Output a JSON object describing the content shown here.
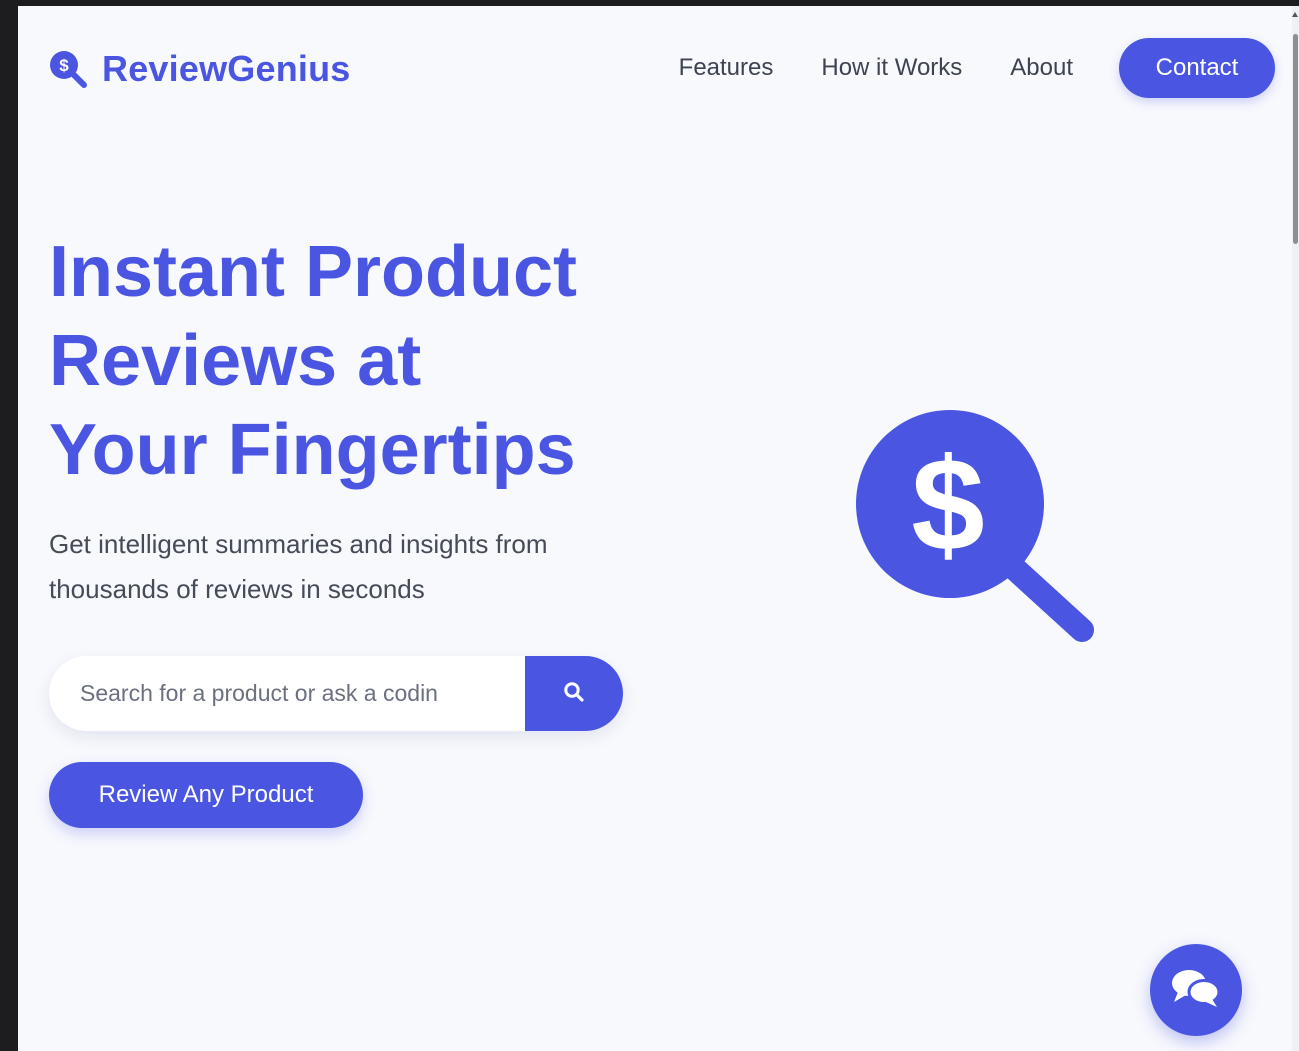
{
  "brand": {
    "name": "ReviewGenius",
    "accent_color": "#4a56e2",
    "logo_icon": "dollar-magnifier-icon"
  },
  "nav": {
    "links": [
      "Features",
      "How it Works",
      "About"
    ],
    "contact_label": "Contact"
  },
  "hero": {
    "title_lines": [
      "Instant Product",
      "Reviews at",
      "Your Fingertips"
    ],
    "subtitle_lines": [
      "Get intelligent summaries and insights from",
      "thousands of reviews in seconds"
    ],
    "search": {
      "placeholder": "Search for a product or ask a codin",
      "button_icon": "search-icon"
    },
    "cta_label": "Review Any Product",
    "illustration_icon": "dollar-magnifier-icon"
  },
  "chat": {
    "icon": "chat-bubbles-icon"
  }
}
